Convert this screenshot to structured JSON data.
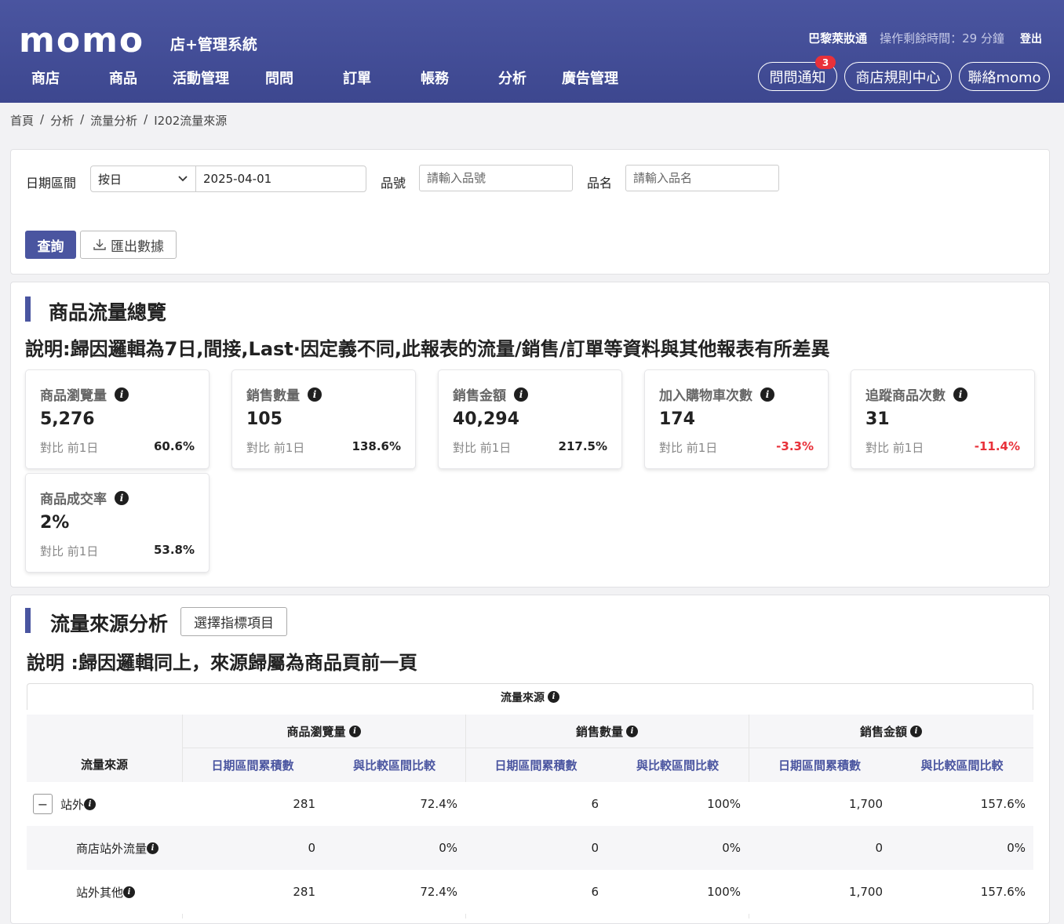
{
  "header": {
    "logo": "momo",
    "system_title": "店+管理系統",
    "user_name": "巴黎萊妝通",
    "timer_text": "操作剩餘時間：29 分鐘",
    "logout": "登出",
    "nav": [
      "商店",
      "商品",
      "活動管理",
      "問問",
      "訂單",
      "帳務",
      "分析",
      "廣告管理"
    ],
    "buttons": {
      "notice": "問問通知",
      "notice_badge": "3",
      "rules": "商店規則中心",
      "contact": "聯絡momo"
    }
  },
  "breadcrumb": [
    "首頁",
    "分析",
    "流量分析",
    "I202流量來源"
  ],
  "filter": {
    "date_label": "日期區間",
    "date_mode": "按日",
    "date_value": "2025-04-01",
    "sku_label": "品號",
    "sku_placeholder": "請輸入品號",
    "name_label": "品名",
    "name_placeholder": "請輸入品名",
    "query_button": "查詢",
    "export_button": "匯出數據"
  },
  "overview": {
    "title": "商品流量總覽",
    "description": "說明:歸因邏輯為7日,間接,Last·因定義不同,此報表的流量/銷售/訂單等資料與其他報表有所差異",
    "compare_label": "對比 前1日",
    "cards": [
      {
        "title": "商品瀏覽量",
        "value": "5,276",
        "pct": "60.6%",
        "negative": false
      },
      {
        "title": "銷售數量",
        "value": "105",
        "pct": "138.6%",
        "negative": false
      },
      {
        "title": "銷售金額",
        "value": "40,294",
        "pct": "217.5%",
        "negative": false
      },
      {
        "title": "加入購物車次數",
        "value": "174",
        "pct": "-3.3%",
        "negative": true
      },
      {
        "title": "追蹤商品次數",
        "value": "31",
        "pct": "-11.4%",
        "negative": true
      },
      {
        "title": "商品成交率",
        "value": "2%",
        "pct": "53.8%",
        "negative": false
      }
    ]
  },
  "source": {
    "title": "流量來源分析",
    "select_button": "選擇指標項目",
    "description": "說明 :歸因邏輯同上，來源歸屬為商品頁前一頁",
    "table_title": "流量來源",
    "row_header": "流量來源",
    "groups": [
      "商品瀏覽量",
      "銷售數量",
      "銷售金額"
    ],
    "sub_headers": [
      "日期區間累積數",
      "與比較區間比較"
    ],
    "rows": [
      {
        "name": "站外",
        "expandable": true,
        "values": [
          "281",
          "72.4%",
          "6",
          "100%",
          "1,700",
          "157.6%"
        ]
      },
      {
        "name": "商店站外流量",
        "expandable": false,
        "values": [
          "0",
          "0%",
          "0",
          "0%",
          "0",
          "0%"
        ]
      },
      {
        "name": "站外其他",
        "expandable": false,
        "values": [
          "281",
          "72.4%",
          "6",
          "100%",
          "1,700",
          "157.6%"
        ]
      }
    ]
  }
}
